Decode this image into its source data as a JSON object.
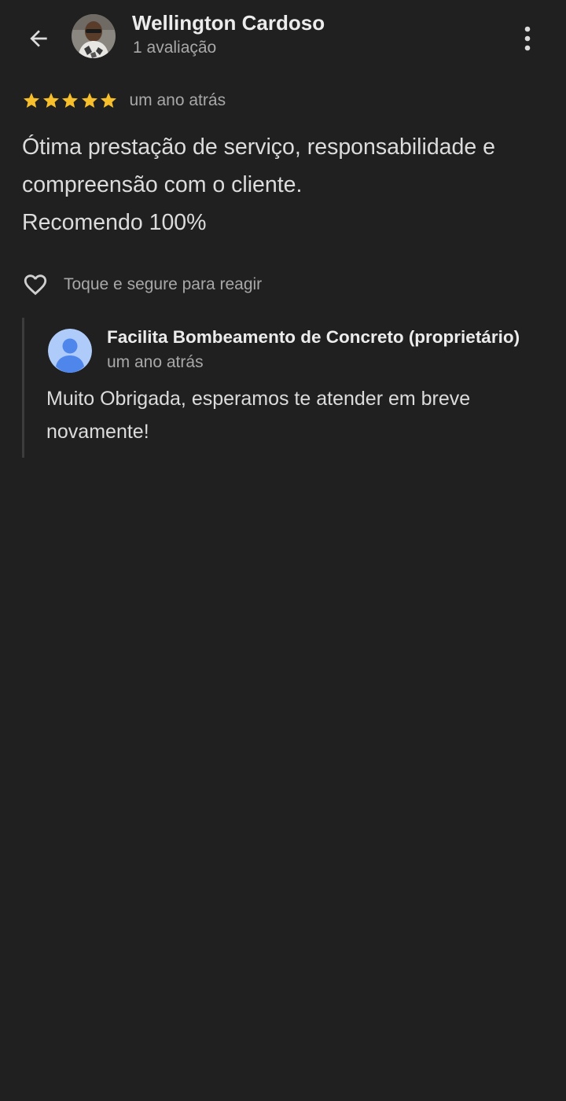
{
  "header": {
    "back_icon": "arrow-left-icon",
    "reviewer_name": "Wellington Cardoso",
    "reviewer_count": "1 avaliação",
    "more_icon": "more-vert-icon"
  },
  "review": {
    "rating": 5,
    "rating_max": 5,
    "star_color": "#f8bf2c",
    "time": "um ano atrás",
    "text": "Ótima prestação de serviço, responsabilidade e compreensão com o cliente.\nRecomendo 100%"
  },
  "reaction": {
    "icon": "heart-outline-icon",
    "label": "Toque e segure para reagir"
  },
  "owner_reply": {
    "name": "Facilita Bombeamento de Concreto (proprietário)",
    "time": "um ano atrás",
    "text": "Muito Obrigada, esperamos te atender em breve novamente!",
    "avatar_color": "#4f86ec"
  }
}
